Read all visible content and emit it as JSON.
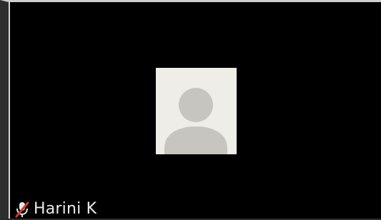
{
  "participant": {
    "name": "Harini K",
    "mic_state": "muted",
    "mic_icon": "microphone-muted-icon",
    "avatar_icon": "default-user-avatar-icon"
  },
  "colors": {
    "tile_background": "#000000",
    "avatar_background": "#efede8",
    "avatar_silhouette": "#c7c5bf",
    "mic_slash": "#d4372c",
    "name_text": "#ececec"
  }
}
